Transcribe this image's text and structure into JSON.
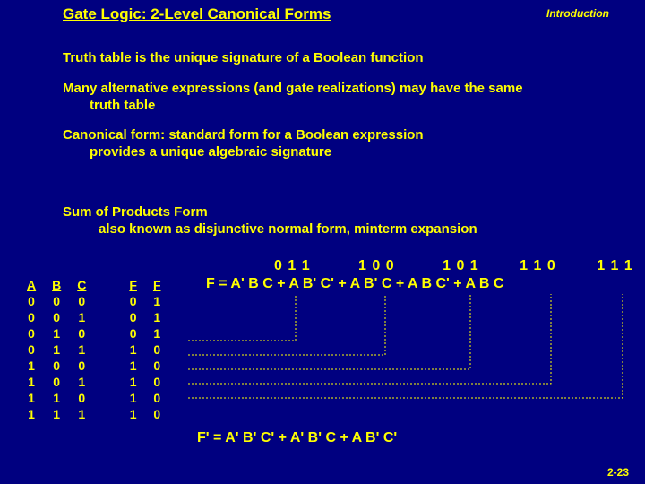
{
  "title": "Gate Logic: 2-Level Canonical Forms",
  "section": "Introduction",
  "para1": "Truth table is the unique signature of a Boolean function",
  "para2a": "Many alternative expressions (and gate realizations) may have the same",
  "para2b": "truth table",
  "para3a": "Canonical form:  standard form for a Boolean expression",
  "para3b": "provides a unique algebraic signature",
  "para4a": "Sum of Products Form",
  "para4b": "also known as disjunctive normal form, minterm expansion",
  "tt": {
    "headers": [
      "A",
      "B",
      "C",
      "F",
      "F"
    ],
    "rows": [
      [
        "0",
        "0",
        "0",
        "0",
        "1"
      ],
      [
        "0",
        "0",
        "1",
        "0",
        "1"
      ],
      [
        "0",
        "1",
        "0",
        "0",
        "1"
      ],
      [
        "0",
        "1",
        "1",
        "1",
        "0"
      ],
      [
        "1",
        "0",
        "0",
        "1",
        "0"
      ],
      [
        "1",
        "0",
        "1",
        "1",
        "0"
      ],
      [
        "1",
        "1",
        "0",
        "1",
        "0"
      ],
      [
        "1",
        "1",
        "1",
        "1",
        "0"
      ]
    ]
  },
  "tags": {
    "t0": "0 1 1",
    "t1": "1 0 0",
    "t2": "1 0 1",
    "t3": "1 1 0",
    "t4": "1 1 1"
  },
  "eq": "F = A' B C  +  A B' C'  +  A B' C  +  A B C'  +  A B C",
  "fprime": "F' = A' B' C'  +  A' B' C  +  A B' C'",
  "pagenum": "2-23",
  "chart_data": {
    "type": "table",
    "title": "Truth table for F and F'",
    "columns": [
      "A",
      "B",
      "C",
      "F",
      "F'"
    ],
    "rows": [
      [
        0,
        0,
        0,
        0,
        1
      ],
      [
        0,
        0,
        1,
        0,
        1
      ],
      [
        0,
        1,
        0,
        0,
        1
      ],
      [
        0,
        1,
        1,
        1,
        0
      ],
      [
        1,
        0,
        0,
        1,
        0
      ],
      [
        1,
        0,
        1,
        1,
        0
      ],
      [
        1,
        1,
        0,
        1,
        0
      ],
      [
        1,
        1,
        1,
        1,
        0
      ]
    ],
    "minterm_tags": [
      "011",
      "100",
      "101",
      "110",
      "111"
    ],
    "sop_F": "F = A'BC + AB'C' + AB'C + ABC' + ABC",
    "sop_Fprime": "F' = A'B'C' + A'B'C + AB'C'"
  }
}
